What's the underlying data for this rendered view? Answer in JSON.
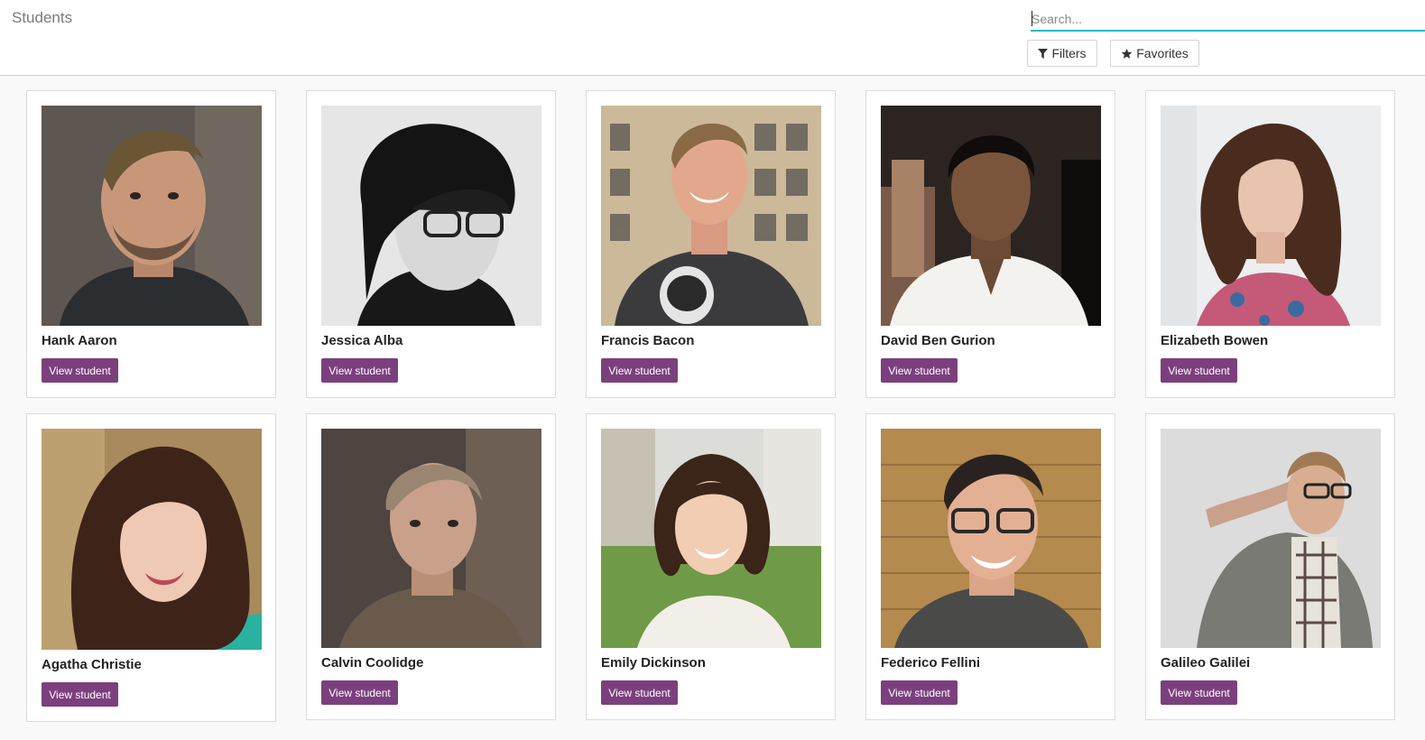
{
  "header": {
    "breadcrumb": "Students",
    "search_placeholder": "Search...",
    "filters_label": "Filters",
    "favorites_label": "Favorites",
    "filter_icon": "filter-icon",
    "favorites_icon": "star-icon"
  },
  "students": [
    {
      "name": "Hank Aaron",
      "button": "View student",
      "photo": "photo-hank-aaron"
    },
    {
      "name": "Jessica Alba",
      "button": "View student",
      "photo": "photo-jessica-alba"
    },
    {
      "name": "Francis Bacon",
      "button": "View student",
      "photo": "photo-francis-bacon"
    },
    {
      "name": "David Ben Gurion",
      "button": "View student",
      "photo": "photo-david-ben-gurion"
    },
    {
      "name": "Elizabeth Bowen",
      "button": "View student",
      "photo": "photo-elizabeth-bowen"
    },
    {
      "name": "Agatha Christie",
      "button": "View student",
      "photo": "photo-agatha-christie"
    },
    {
      "name": "Calvin Coolidge",
      "button": "View student",
      "photo": "photo-calvin-coolidge"
    },
    {
      "name": "Emily Dickinson",
      "button": "View student",
      "photo": "photo-emily-dickinson"
    },
    {
      "name": "Federico Fellini",
      "button": "View student",
      "photo": "photo-federico-fellini"
    },
    {
      "name": "Galileo Galilei",
      "button": "View student",
      "photo": "photo-galileo-galilei"
    }
  ],
  "colors": {
    "accent_button": "#7c3f7e",
    "search_underline": "#20b7c9"
  }
}
